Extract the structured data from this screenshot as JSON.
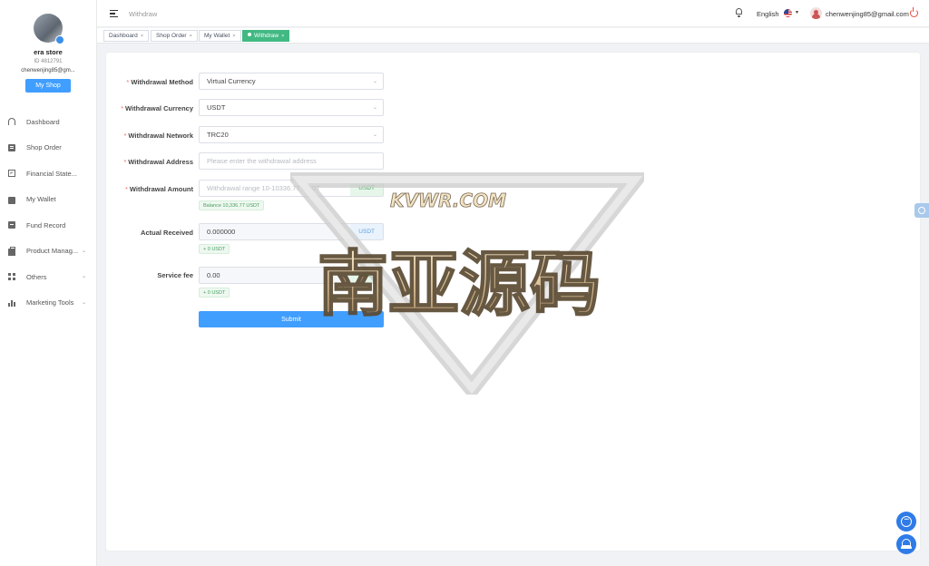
{
  "sidebar": {
    "store_name": "era store",
    "store_id": "ID 4812791",
    "email": "chenwenjing85@gm...",
    "my_shop": "My Shop",
    "items": [
      {
        "label": "Dashboard",
        "icon": "dashboard-icon"
      },
      {
        "label": "Shop Order",
        "icon": "clipboard-icon"
      },
      {
        "label": "Financial State...",
        "icon": "chart-icon"
      },
      {
        "label": "My Wallet",
        "icon": "wallet-icon"
      },
      {
        "label": "Fund Record",
        "icon": "record-icon"
      },
      {
        "label": "Product Manag...",
        "icon": "bag-icon",
        "expandable": true
      },
      {
        "label": "Others",
        "icon": "grid-icon",
        "expandable": true
      },
      {
        "label": "Marketing Tools",
        "icon": "bar-chart-icon",
        "expandable": true
      }
    ]
  },
  "header": {
    "breadcrumb": "Withdraw",
    "language": "English",
    "user_email": "chenwenjing85@gmail.com"
  },
  "tabs": [
    {
      "label": "Dashboard",
      "active": false
    },
    {
      "label": "Shop Order",
      "active": false
    },
    {
      "label": "My Wallet",
      "active": false
    },
    {
      "label": "Withdraw",
      "active": true
    }
  ],
  "form": {
    "method": {
      "label": "Withdrawal Method",
      "value": "Virtual Currency"
    },
    "currency": {
      "label": "Withdrawal Currency",
      "value": "USDT"
    },
    "network": {
      "label": "Withdrawal Network",
      "value": "TRC20"
    },
    "address": {
      "label": "Withdrawal Address",
      "placeholder": "Please enter the withdrawal address"
    },
    "amount": {
      "label": "Withdrawal Amount",
      "placeholder": "Withdrawal range 10-10336.77 USDT",
      "suffix": "USDT",
      "balance": "Balance 10,336.77 USDT"
    },
    "received": {
      "label": "Actual Received",
      "value": "0.000000",
      "suffix": "USDT",
      "tag": "+ 0 USDT"
    },
    "fee": {
      "label": "Service fee",
      "value": "0.00",
      "suffix": "USDT",
      "tag": "+ 0 USDT"
    },
    "submit": "Submit"
  },
  "watermark": {
    "line1": "KVWR.COM",
    "line2": "南亚源码"
  },
  "colors": {
    "primary": "#409eff",
    "active_tab": "#42b983",
    "required": "#f56c6c"
  }
}
